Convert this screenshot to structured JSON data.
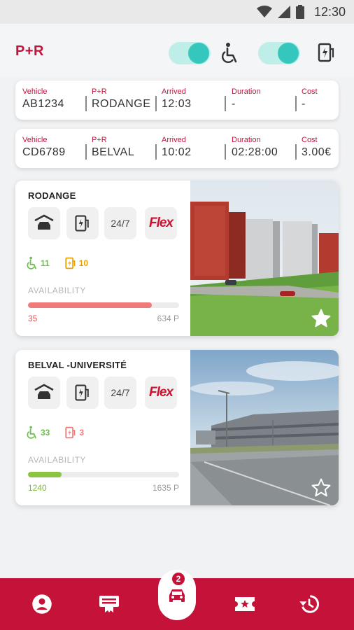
{
  "status_bar": {
    "time": "12:30"
  },
  "app": {
    "brand": "P+R"
  },
  "filters": {
    "accessible_toggle_on": true,
    "ev_toggle_on": true
  },
  "sessions": [
    {
      "labels": {
        "vehicle": "Vehicle",
        "pr": "P+R",
        "arrived": "Arrived",
        "duration": "Duration",
        "cost": "Cost"
      },
      "vehicle": "AB1234",
      "pr": "RODANGE",
      "arrived": "12:03",
      "duration": "-",
      "cost": "-"
    },
    {
      "labels": {
        "vehicle": "Vehicle",
        "pr": "P+R",
        "arrived": "Arrived",
        "duration": "Duration",
        "cost": "Cost"
      },
      "vehicle": "CD6789",
      "pr": "BELVAL",
      "arrived": "10:02",
      "duration": "02:28:00",
      "cost": "3.00€"
    }
  ],
  "lots": [
    {
      "name": "RODANGE",
      "features": {
        "hours": "24/7",
        "flex": "Flex"
      },
      "accessible_count": "11",
      "ev_count": "10",
      "ev_color": "#e8a300",
      "availability_label": "AVAILABILITY",
      "available": "35",
      "total": "634 P",
      "available_fraction": 0.82,
      "bar_color": "#f07a7a",
      "available_color": "#e45757",
      "favorite": true
    },
    {
      "name": "BELVAL -UNIVERSITÉ",
      "features": {
        "hours": "24/7",
        "flex": "Flex"
      },
      "accessible_count": "33",
      "ev_count": "3",
      "ev_color": "#f07a7a",
      "availability_label": "AVAILABILITY",
      "available": "1240",
      "total": "1635 P",
      "available_fraction": 0.22,
      "bar_color": "#8bc53f",
      "available_color": "#7db83a",
      "favorite": false
    }
  ],
  "nav": {
    "items": [
      "profile-icon",
      "ticket-icon",
      "car-icon",
      "favorites-icon",
      "history-icon"
    ],
    "active": "car-icon",
    "badge": "2"
  },
  "colors": {
    "brand_red": "#c41239",
    "accessible_green": "#6cc24a",
    "teal": "#35c7bd"
  }
}
